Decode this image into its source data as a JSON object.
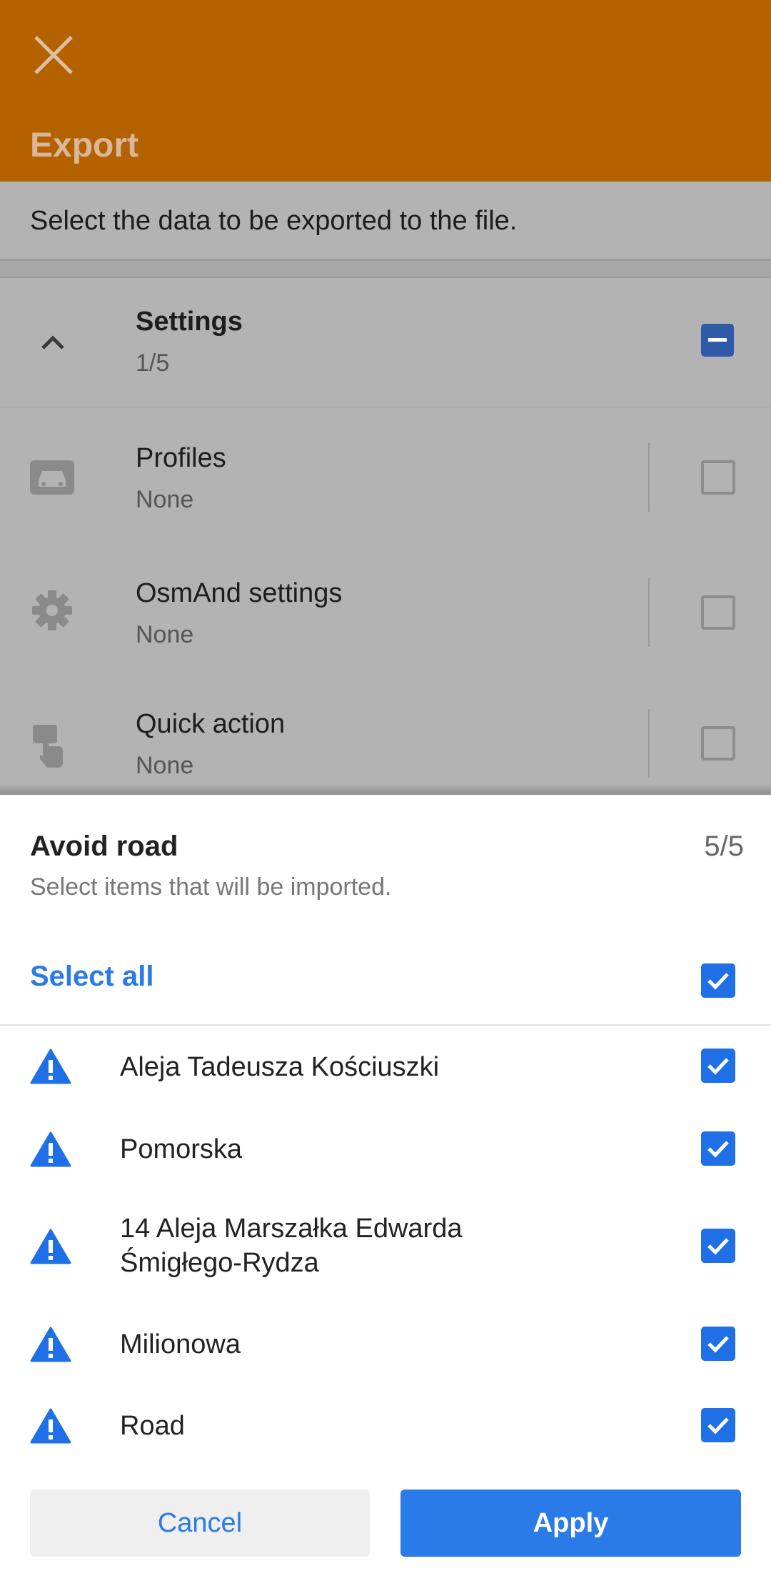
{
  "appbar": {
    "title": "Export"
  },
  "description": "Select the data to be exported to the file.",
  "group": {
    "title": "Settings",
    "count": "1/5"
  },
  "items": [
    {
      "title": "Profiles",
      "subtitle": "None",
      "icon": "car-icon"
    },
    {
      "title": "OsmAnd settings",
      "subtitle": "None",
      "icon": "gear-icon"
    },
    {
      "title": "Quick action",
      "subtitle": "None",
      "icon": "touch-icon"
    }
  ],
  "sheet": {
    "title": "Avoid road",
    "count": "5/5",
    "subtitle": "Select items that will be imported.",
    "select_all": "Select all",
    "roads": [
      "Aleja Tadeusza Kościuszki",
      "Pomorska",
      "14 Aleja Marszałka Edwarda\nŚmigłego-Rydza",
      "Milionowa",
      "Road"
    ],
    "cancel": "Cancel",
    "apply": "Apply"
  },
  "colors": {
    "accent": "#2a7ae8",
    "appbar": "#b46200",
    "checkbox_checked": "#1f70e6"
  }
}
